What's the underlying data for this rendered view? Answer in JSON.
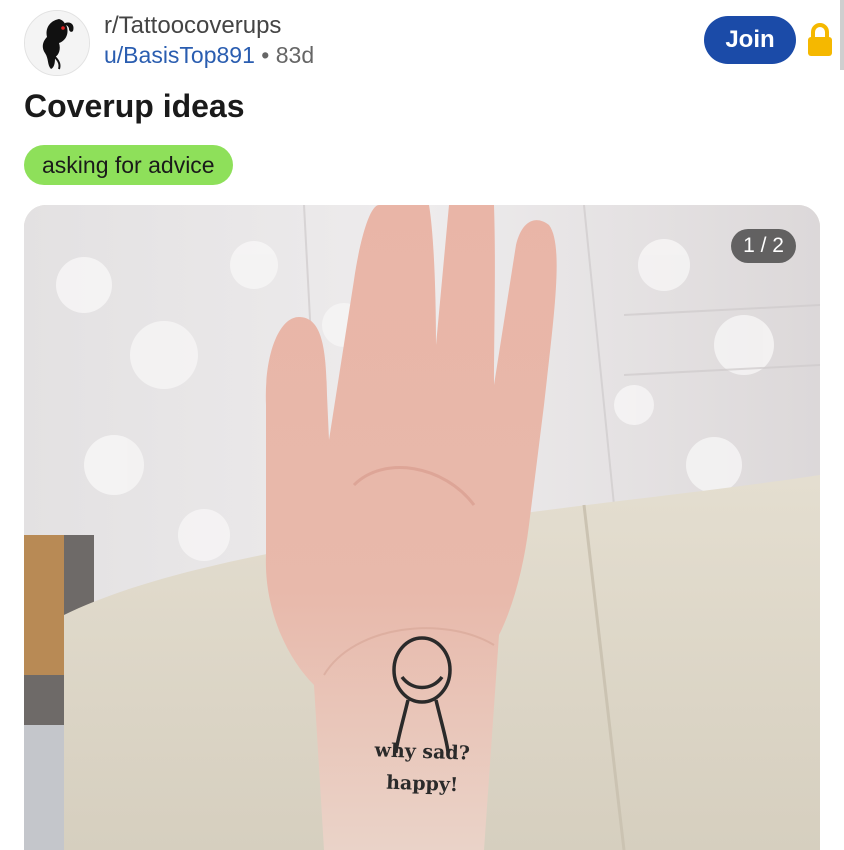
{
  "post": {
    "subreddit": "r/Tattoocoverups",
    "author": "u/BasisTop891",
    "separator": "•",
    "age": "83d",
    "title": "Coverup ideas",
    "flair": "asking for advice",
    "join_label": "Join",
    "image_counter": "1 / 2"
  },
  "tattoo": {
    "line1": "why sad?",
    "line2": "happy!"
  },
  "colors": {
    "join_button": "#1b4ba8",
    "flair": "#8ee05a",
    "lock": "#f5b800",
    "username": "#2a5db0"
  },
  "icons": {
    "avatar": "panther-avatar-icon",
    "lock": "lock-icon"
  }
}
